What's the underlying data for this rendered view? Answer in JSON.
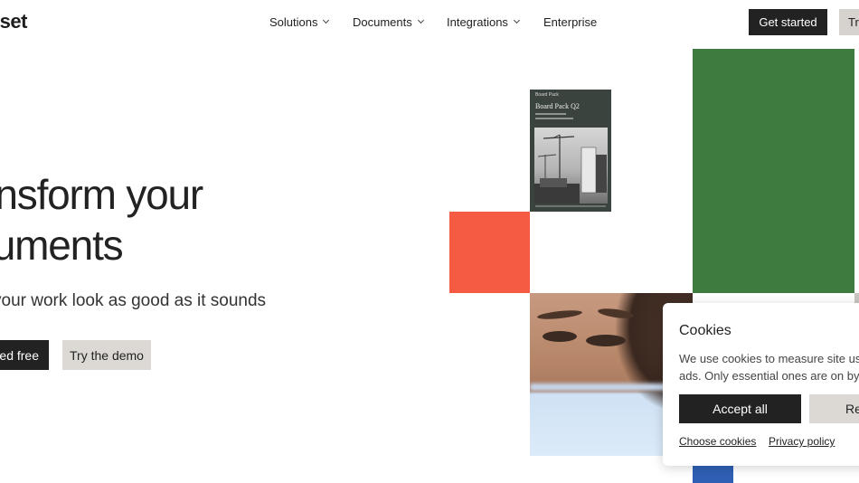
{
  "header": {
    "logo_text": "lset",
    "nav": [
      {
        "label": "Solutions",
        "has_dropdown": true
      },
      {
        "label": "Documents",
        "has_dropdown": true
      },
      {
        "label": "Integrations",
        "has_dropdown": true
      },
      {
        "label": "Enterprise",
        "has_dropdown": false
      }
    ],
    "get_started_label": "Get started",
    "try_label": "Tr"
  },
  "hero": {
    "headline_line1": "ansform your",
    "headline_line2": "cuments",
    "subheadline": "your work look as good as it sounds",
    "cta_primary": "ted free",
    "cta_secondary": "Try the demo"
  },
  "document_preview": {
    "brand": "Board Pack",
    "title": "Board Pack Q2"
  },
  "cookie_banner": {
    "title": "Cookies",
    "body_line1": "We use cookies to measure site usa",
    "body_line2": "ads. Only essential ones are on by d",
    "accept_label": "Accept all",
    "reject_label": "Re",
    "choose_link": "Choose cookies",
    "privacy_link": "Privacy policy"
  },
  "colors": {
    "accent_green": "#3e7b3e",
    "accent_red": "#f45b42",
    "accent_blue": "#2f5fb4",
    "dark_button": "#222222",
    "light_button": "#dcd9d5"
  }
}
